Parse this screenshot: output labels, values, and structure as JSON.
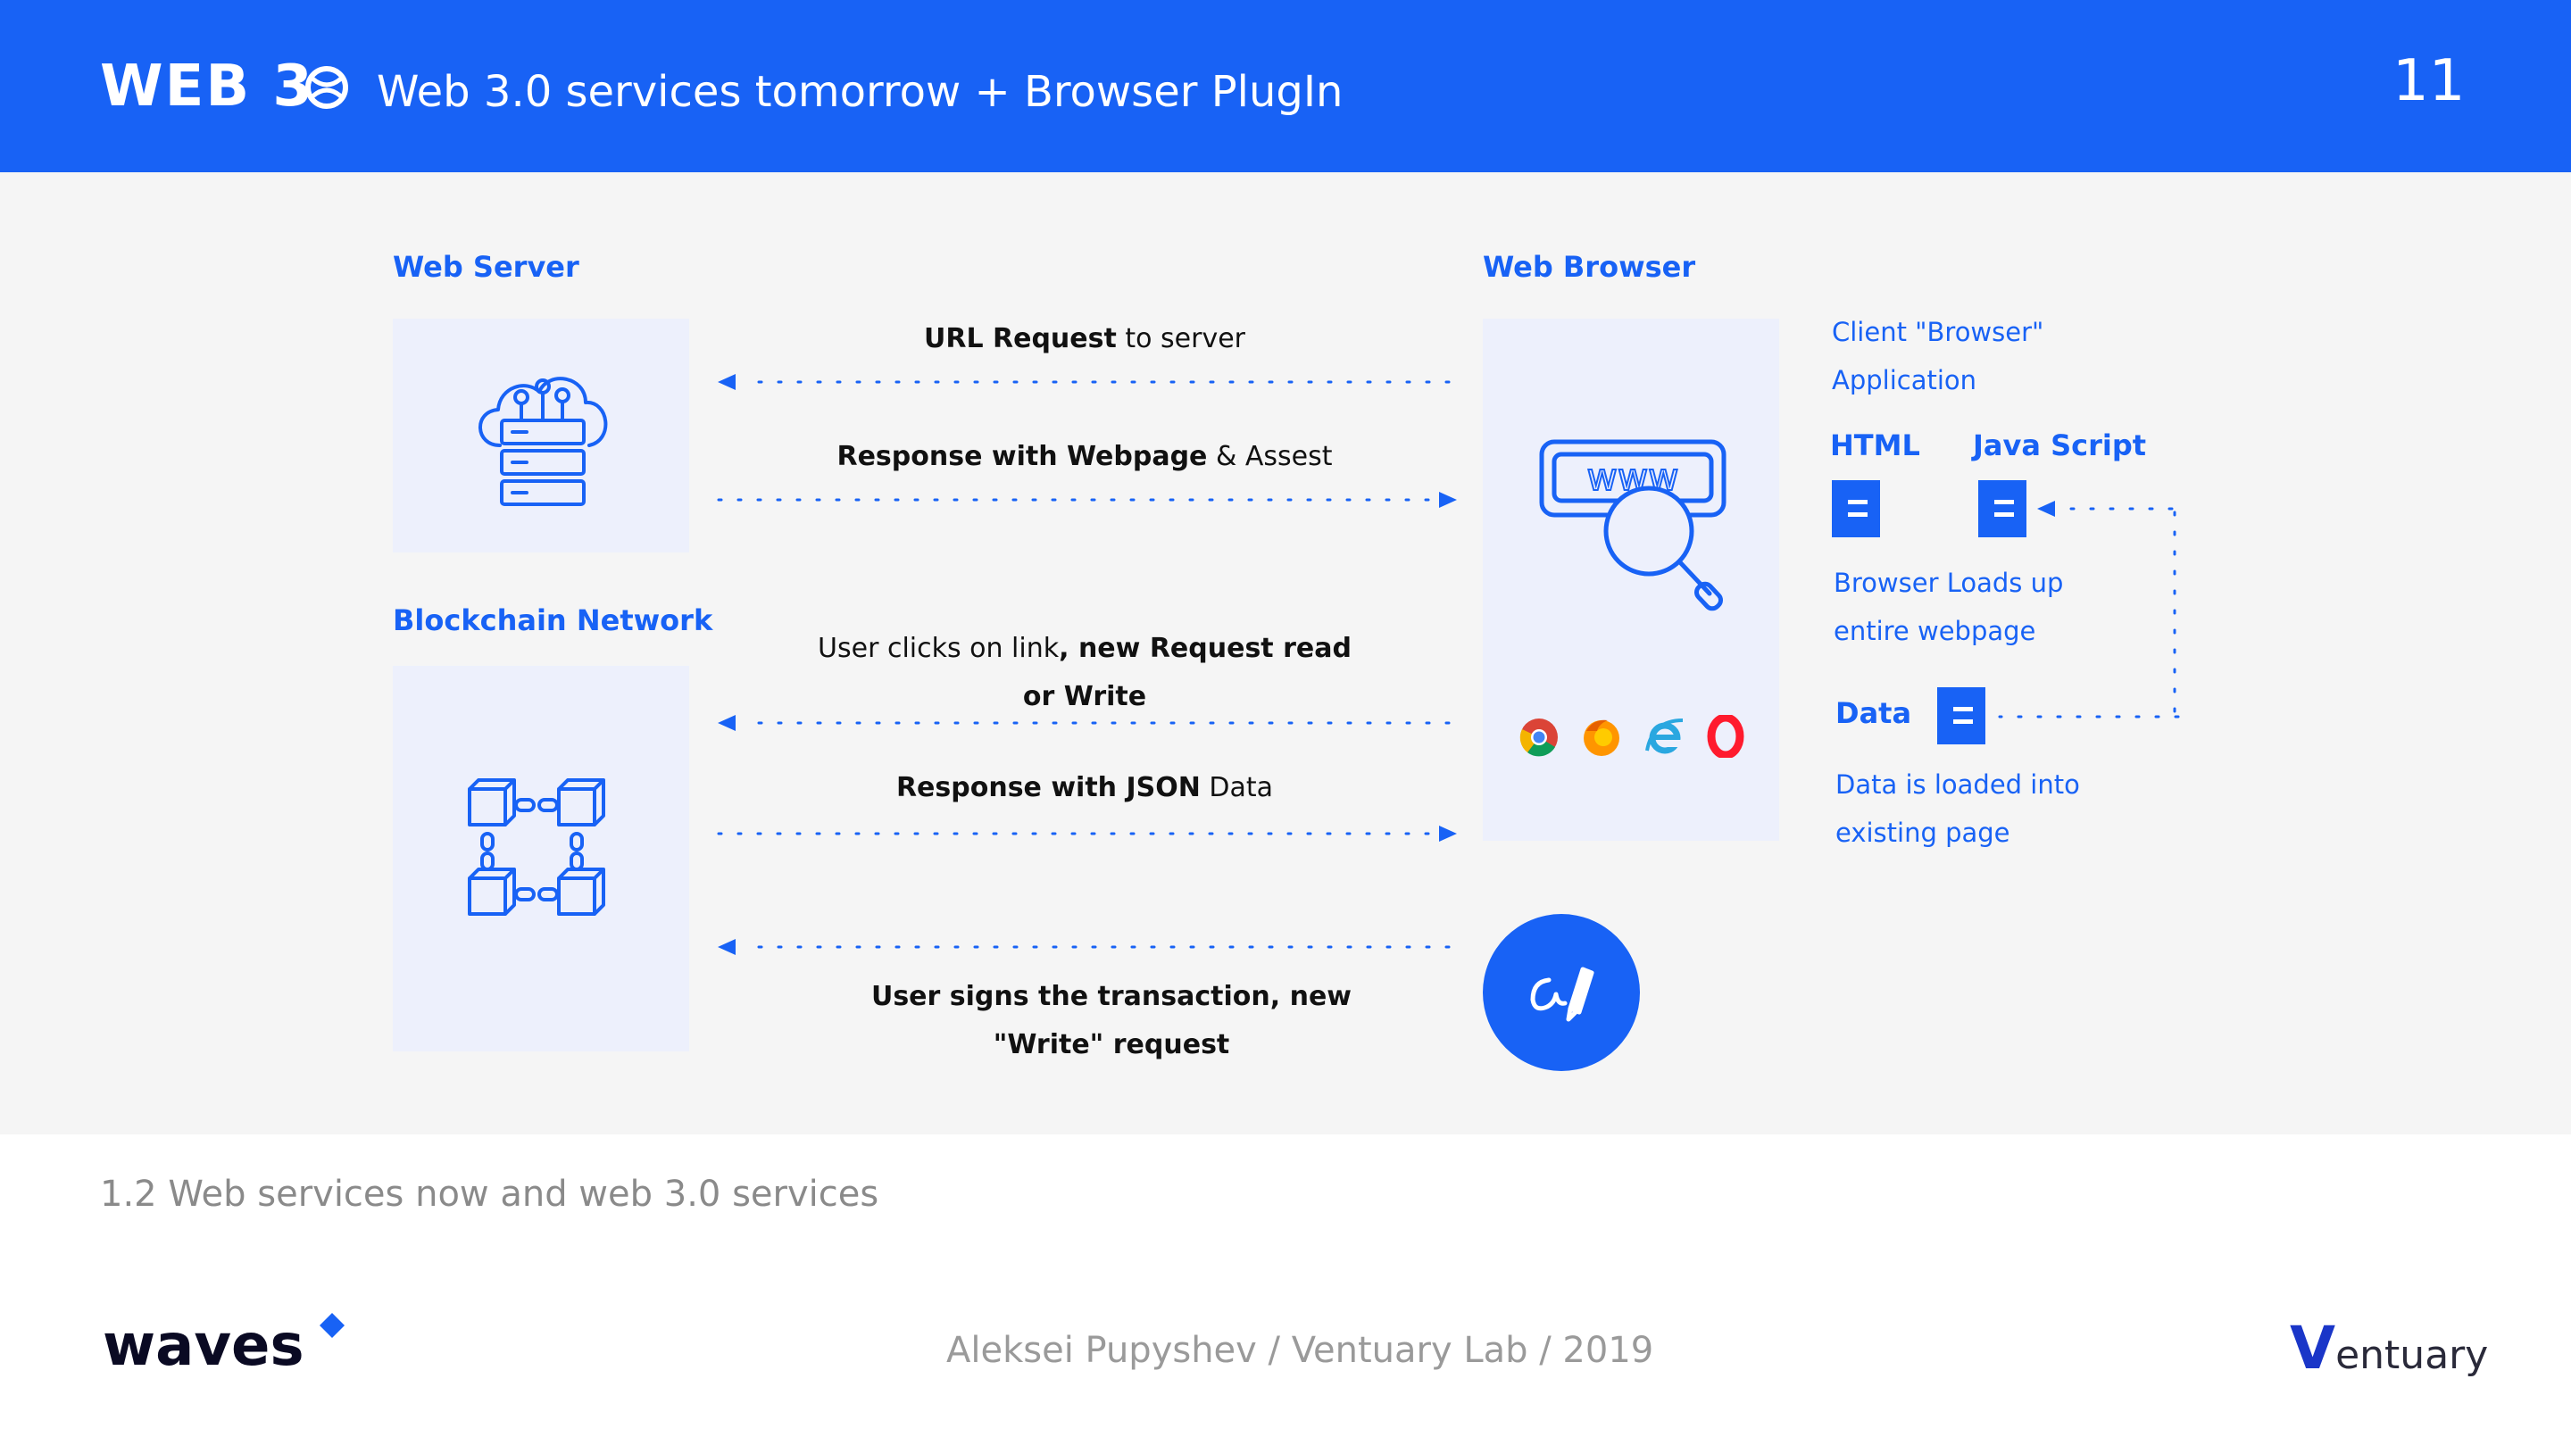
{
  "header": {
    "logo_text": "WEB 3",
    "title": "Web 3.0 services tomorrow + Browser PlugIn",
    "page_number": "11"
  },
  "diagram": {
    "web_server": {
      "label": "Web Server"
    },
    "blockchain": {
      "label": "Blockchain Network"
    },
    "web_browser": {
      "label": "Web Browser",
      "address_text": "www"
    },
    "messages": {
      "m1": {
        "bold": "URL Request",
        "rest": " to server"
      },
      "m2": {
        "bold": "Response with Webpage",
        "rest": " & Assest"
      },
      "m3": {
        "line1_normal": "User clicks on link",
        "line1_bold": ", new Request read",
        "line2_bold": "or Write"
      },
      "m4": {
        "bold": "Response with JSON",
        "rest": " Data"
      },
      "m5": {
        "line1": "User signs the transaction, new",
        "line2": "\"Write\" request"
      }
    },
    "client": {
      "line1": "Client \"Browser\"",
      "line2": "Application",
      "html_label": "HTML",
      "js_label": "Java Script",
      "loads_line1": "Browser Loads up",
      "loads_line2": "entire webpage",
      "data_label": "Data",
      "data_line1": "Data is loaded into",
      "data_line2": "existing page"
    },
    "browser_icons": [
      "chrome-icon",
      "firefox-icon",
      "ie-icon",
      "opera-icon"
    ]
  },
  "footer": {
    "caption": "1.2  Web services now and web 3.0 services",
    "brand_left": "waves",
    "center": "Aleksei Pupyshev / Ventuary Lab / 2019",
    "brand_right_v": "V",
    "brand_right_rest": "entuary"
  },
  "colors": {
    "accent": "#1862f5",
    "panel": "#edf0fc",
    "background": "#f5f5f5"
  }
}
